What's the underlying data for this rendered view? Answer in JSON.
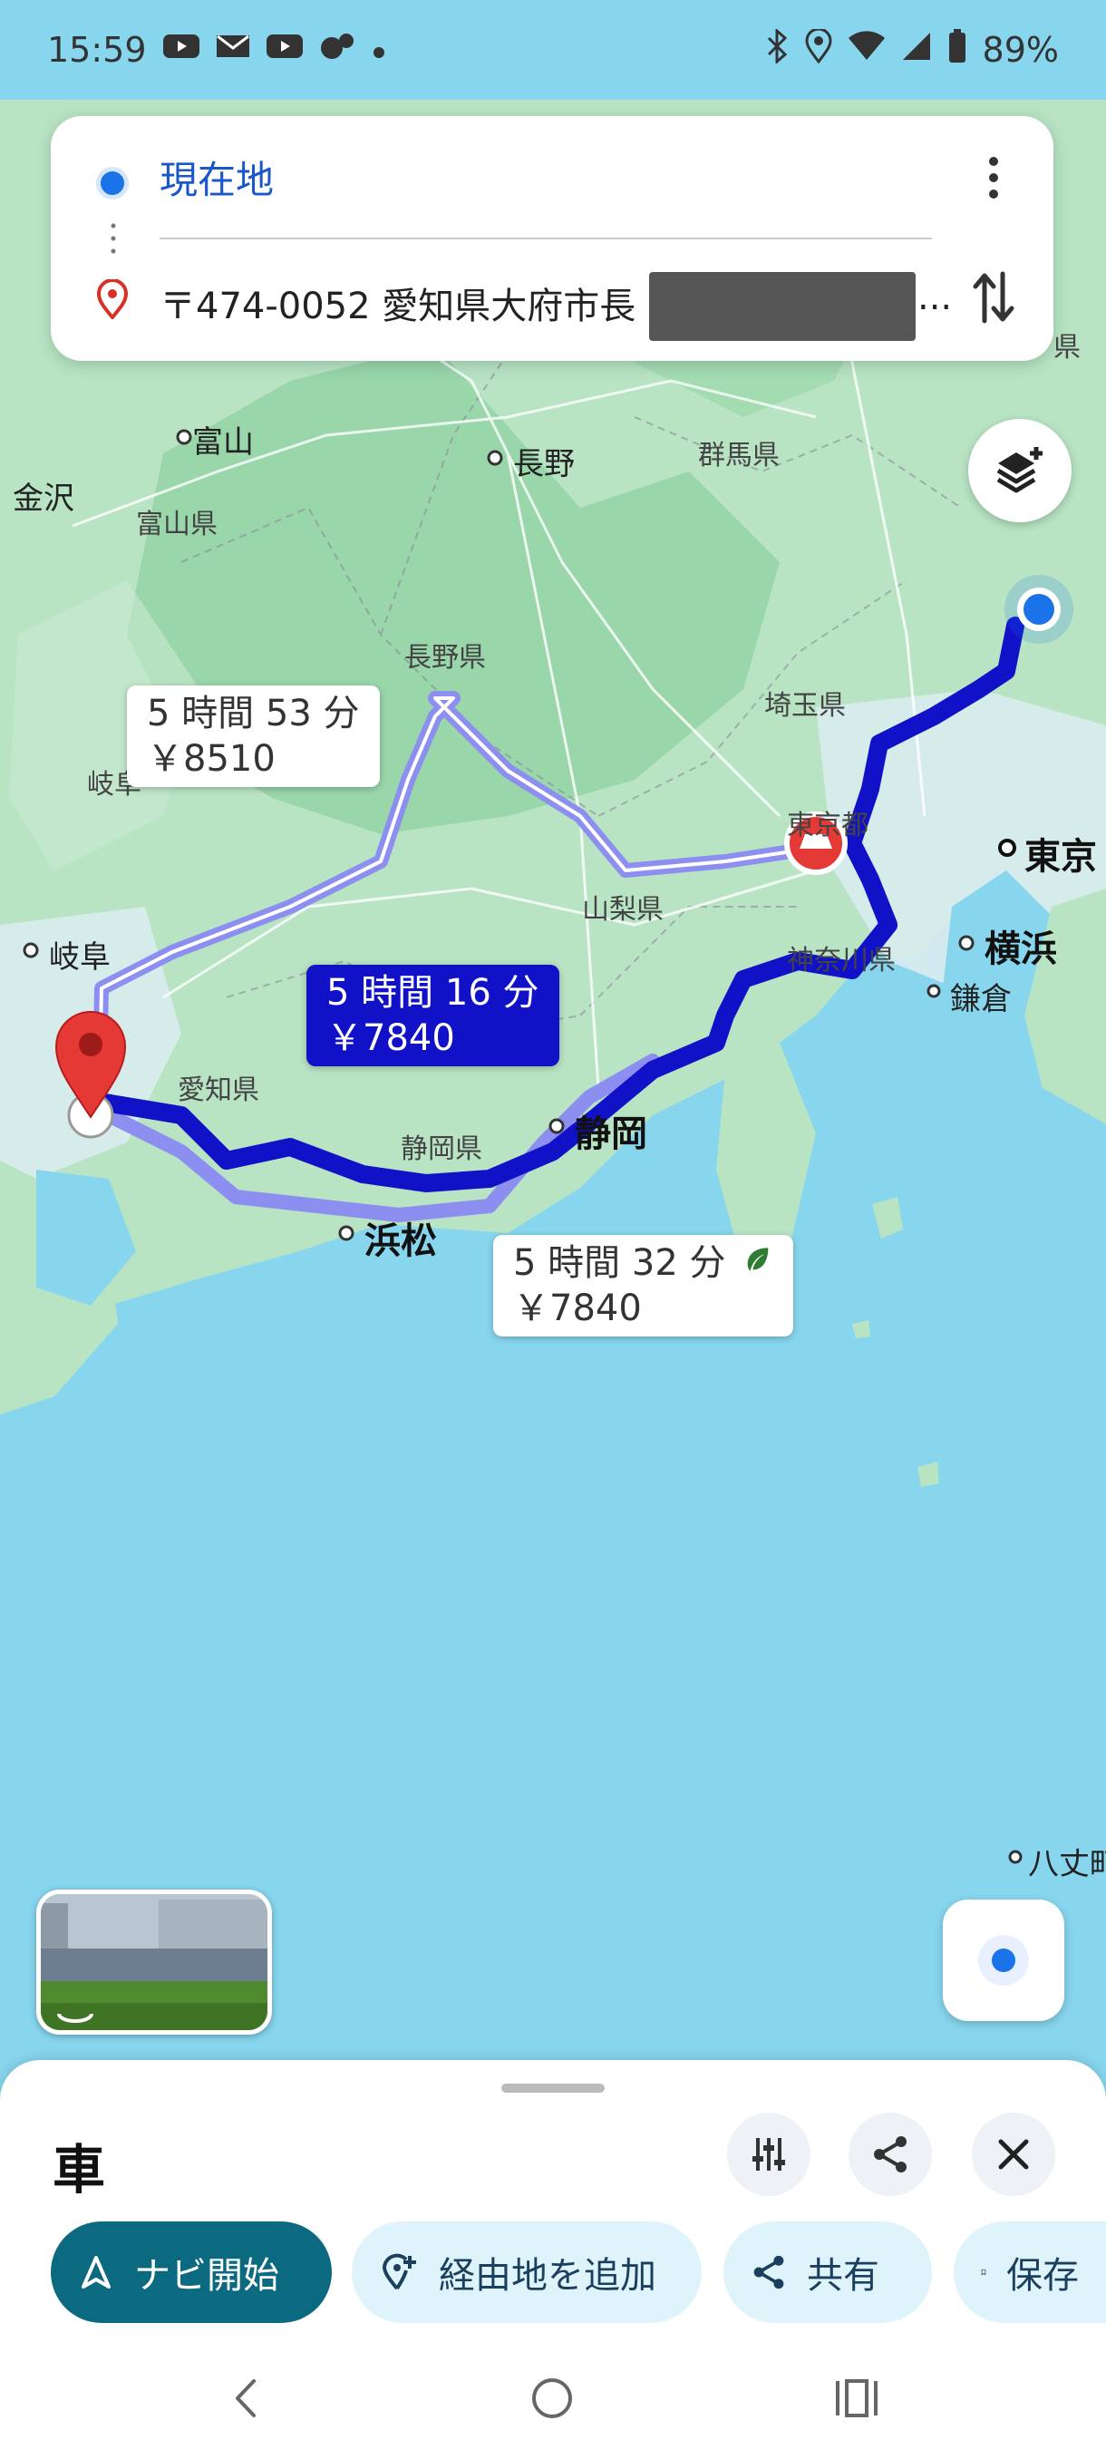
{
  "status_bar": {
    "time": "15:59",
    "battery": "89%",
    "left_icons": [
      "youtube-icon",
      "mail-icon",
      "youtube-icon",
      "jimoty-icon",
      "dot-icon"
    ],
    "right_icons": [
      "bluetooth-icon",
      "location-icon",
      "wifi-icon",
      "signal-icon",
      "battery-icon"
    ]
  },
  "directions": {
    "origin": "現在地",
    "destination": "〒474-0052 愛知県大府市長",
    "destination_ellipsis": "..."
  },
  "routes": [
    {
      "duration": "5 時間 53 分",
      "toll": "￥8510",
      "selected": false,
      "eco": false
    },
    {
      "duration": "5 時間 16 分",
      "toll": "￥7840",
      "selected": true,
      "eco": false
    },
    {
      "duration": "5 時間 32 分",
      "toll": "￥7840",
      "selected": false,
      "eco": true
    }
  ],
  "map_labels": {
    "toyama": "富山",
    "kanazawa": "金沢",
    "toyama_pref": "富山県",
    "nagano": "長野",
    "gunma": "群馬県",
    "nagano_pref": "長野県",
    "saitama": "埼玉県",
    "gifu_pref": "岐阜",
    "tokyo_pref": "東京都",
    "tokyo": "東京",
    "yamanashi": "山梨県",
    "gifu": "岐阜",
    "kanagawa": "神奈川県",
    "yokohama": "横浜",
    "kamakura": "鎌倉",
    "aichi": "愛知県",
    "shizuoka_pref": "静岡県",
    "shizuoka": "静岡",
    "hamamatsu": "浜松",
    "hachijo": "八丈町",
    "ken": "県"
  },
  "bottom_sheet": {
    "mode_title": "車",
    "chips": {
      "navigate": "ナビ開始",
      "add_stop": "経由地を追加",
      "share": "共有",
      "save": "保存"
    }
  },
  "colors": {
    "selected_route": "#1111c8",
    "alt_route": "#8c8ff0",
    "sea": "#87d6ee",
    "land": "#b6e3c6",
    "primary_chip": "#0b6a80",
    "chip": "#dff3fb",
    "pin": "#e53935"
  }
}
